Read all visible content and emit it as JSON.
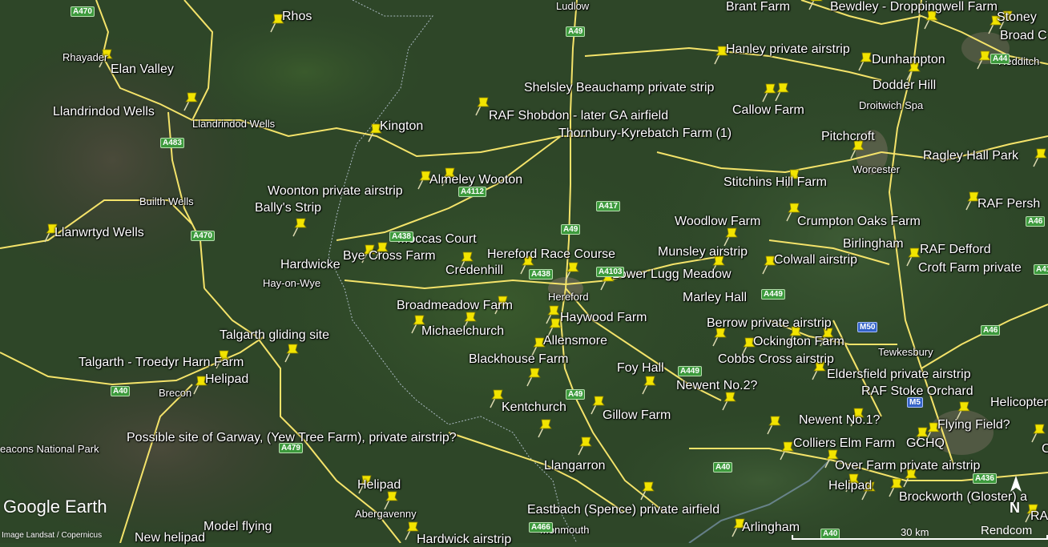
{
  "labels": [
    {
      "t": "Rhos"
    },
    {
      "t": "Rhayader",
      "s": "town"
    },
    {
      "t": "Elan Valley"
    },
    {
      "t": "Llandrindod Wells"
    },
    {
      "t": "Llandrindod Wells",
      "s": "town"
    },
    {
      "t": "Kington"
    },
    {
      "t": "Almeley Wooton"
    },
    {
      "t": "Woonton private airstrip"
    },
    {
      "t": "Bally's Strip"
    },
    {
      "t": "Builth Wells",
      "s": "town"
    },
    {
      "t": "Llanwrtyd Wells"
    },
    {
      "t": "Moccas Court"
    },
    {
      "t": "Bye Cross Farm"
    },
    {
      "t": "Credenhill"
    },
    {
      "t": "Hardwicke"
    },
    {
      "t": "Hay-on-Wye",
      "s": "town"
    },
    {
      "t": "Hereford Race Course"
    },
    {
      "t": "Hereford",
      "s": "town"
    },
    {
      "t": "Lower Lugg Meadow"
    },
    {
      "t": "Broadmeadow Farm"
    },
    {
      "t": "Michaelchurch"
    },
    {
      "t": "Haywood Farm"
    },
    {
      "t": "Talgarth gliding site"
    },
    {
      "t": "Allensmore"
    },
    {
      "t": "Talgarth - Troedyr Harn Farm"
    },
    {
      "t": "Helipad"
    },
    {
      "t": "Brecon",
      "s": "town"
    },
    {
      "t": "Blackhouse Farm"
    },
    {
      "t": "Foy Hall"
    },
    {
      "t": "Kentchurch"
    },
    {
      "t": "Gillow Farm"
    },
    {
      "t": "Possible site of Garway, (Yew Tree Farm), private airstrip?"
    },
    {
      "t": "Llangarron"
    },
    {
      "t": "Helipad"
    },
    {
      "t": "Abergavenny",
      "s": "town"
    },
    {
      "t": "Eastbach (Spence) private airfield"
    },
    {
      "t": "Model flying"
    },
    {
      "t": "New helipad"
    },
    {
      "t": "Hardwick airstrip"
    },
    {
      "t": "Monmouth",
      "s": "town"
    },
    {
      "t": "Ludlow",
      "s": "town"
    },
    {
      "t": "Brant Farm"
    },
    {
      "t": "Bewdley - Droppingwell Farm"
    },
    {
      "t": "Hanley private airstrip"
    },
    {
      "t": "Shelsley Beauchamp private strip"
    },
    {
      "t": "RAF Shobdon - later GA airfield"
    },
    {
      "t": "Thornbury-Kyrebatch Farm (1)"
    },
    {
      "t": "Callow Farm"
    },
    {
      "t": "Dunhampton"
    },
    {
      "t": "Dodder Hill"
    },
    {
      "t": "Droitwich Spa",
      "s": "town"
    },
    {
      "t": "Pitchcroft"
    },
    {
      "t": "Worcester",
      "s": "town"
    },
    {
      "t": "Stitchins Hill Farm"
    },
    {
      "t": "Woodlow Farm"
    },
    {
      "t": "Crumpton Oaks Farm"
    },
    {
      "t": "Munsley airstrip"
    },
    {
      "t": "Colwall airstrip"
    },
    {
      "t": "Birlingham"
    },
    {
      "t": "RAF Defford"
    },
    {
      "t": "Croft Farm private"
    },
    {
      "t": "Marley Hall"
    },
    {
      "t": "Berrow private airstrip"
    },
    {
      "t": "Ockington Farm"
    },
    {
      "t": "Cobbs Cross airstrip"
    },
    {
      "t": "Tewkesbury",
      "s": "town"
    },
    {
      "t": "Eldersfield private airstrip"
    },
    {
      "t": "Newent No.2?"
    },
    {
      "t": "RAF Stoke Orchard"
    },
    {
      "t": "Helicopter la"
    },
    {
      "t": "Newent No.1?"
    },
    {
      "t": "Flying Field?"
    },
    {
      "t": "Colliers Elm Farm"
    },
    {
      "t": "GCHQ"
    },
    {
      "t": "Over Farm private airstrip"
    },
    {
      "t": "Helipad"
    },
    {
      "t": "Brockworth (Gloster) a"
    },
    {
      "t": "Arlingham"
    },
    {
      "t": "Ragley Hall Park"
    },
    {
      "t": "RAF Persh"
    },
    {
      "t": "Stoney"
    },
    {
      "t": "Broad C"
    },
    {
      "t": "Redditch",
      "s": "town"
    },
    {
      "t": "eacons National Park",
      "s": "town"
    },
    {
      "t": "RA"
    },
    {
      "t": "C"
    }
  ],
  "roads": [
    "A470",
    "A483",
    "A470",
    "A4112",
    "A49",
    "A417",
    "A438",
    "A4103",
    "A449",
    "A49",
    "A449",
    "A40",
    "A479",
    "A40",
    "A466",
    "M50",
    "M5",
    "A46",
    "A436",
    "A46",
    "A44",
    "A40",
    "A49",
    "A438",
    "A4110"
  ],
  "ui": {
    "logo": "Google Earth",
    "credit": "Image Landsat / Copernicus",
    "scale": "30 km",
    "brand": "Rendcom",
    "north": "N"
  },
  "colors": {
    "pin": "#f2e400",
    "road": "#f4e36a",
    "border": "#c9d6e8",
    "water": "#8aa5c8"
  }
}
